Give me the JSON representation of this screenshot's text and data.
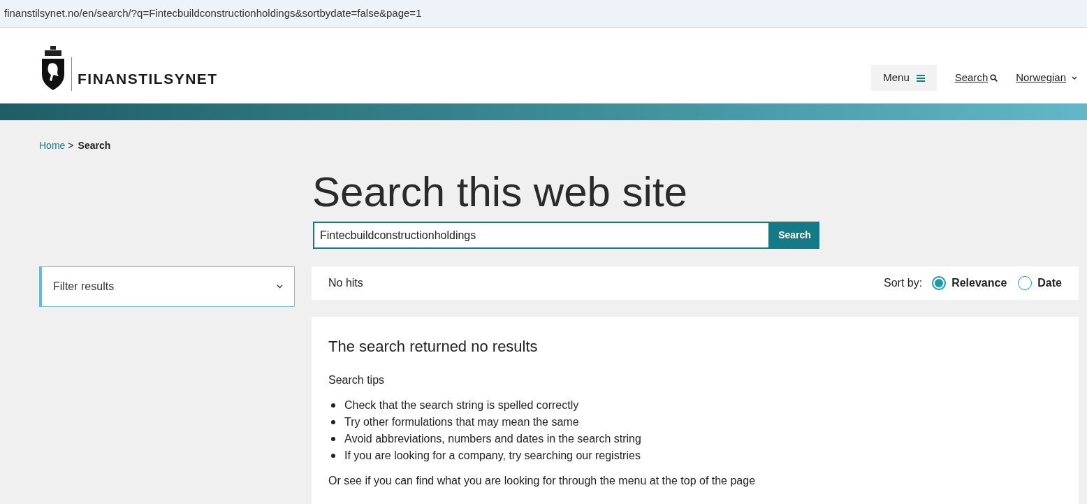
{
  "address_bar": {
    "url": "finanstilsynet.no/en/search/?q=Fintecbuildconstructionholdings&sortbydate=false&page=1"
  },
  "header": {
    "logo_text": "FINANSTILSYNET",
    "menu_button": "Menu",
    "search_link": "Search",
    "language": "Norwegian"
  },
  "breadcrumb": [
    {
      "label": "Home",
      "link": true
    },
    {
      "label": "Search",
      "link": false
    }
  ],
  "breadcrumb_separator": ">",
  "title": "Search this web site",
  "search": {
    "value": "Fintecbuildconstructionholdings",
    "button": "Search"
  },
  "filter": {
    "label": "Filter results",
    "expanded": false
  },
  "results_bar": {
    "count": "No hits",
    "sort_label": "Sort by:",
    "options": [
      {
        "label": "Relevance",
        "selected": true
      },
      {
        "label": "Date",
        "selected": false
      }
    ]
  },
  "no_results": {
    "heading": "The search returned no results",
    "tips_title": "Search tips",
    "tips": [
      "Check that the search string is spelled correctly",
      "Try other formulations that may mean the same",
      "Avoid abbreviations, numbers and dates in the search string",
      "If you are looking for a company, try searching our registries"
    ],
    "footer": "Or see if you can find what you are looking for through the menu at the top of the page"
  }
}
